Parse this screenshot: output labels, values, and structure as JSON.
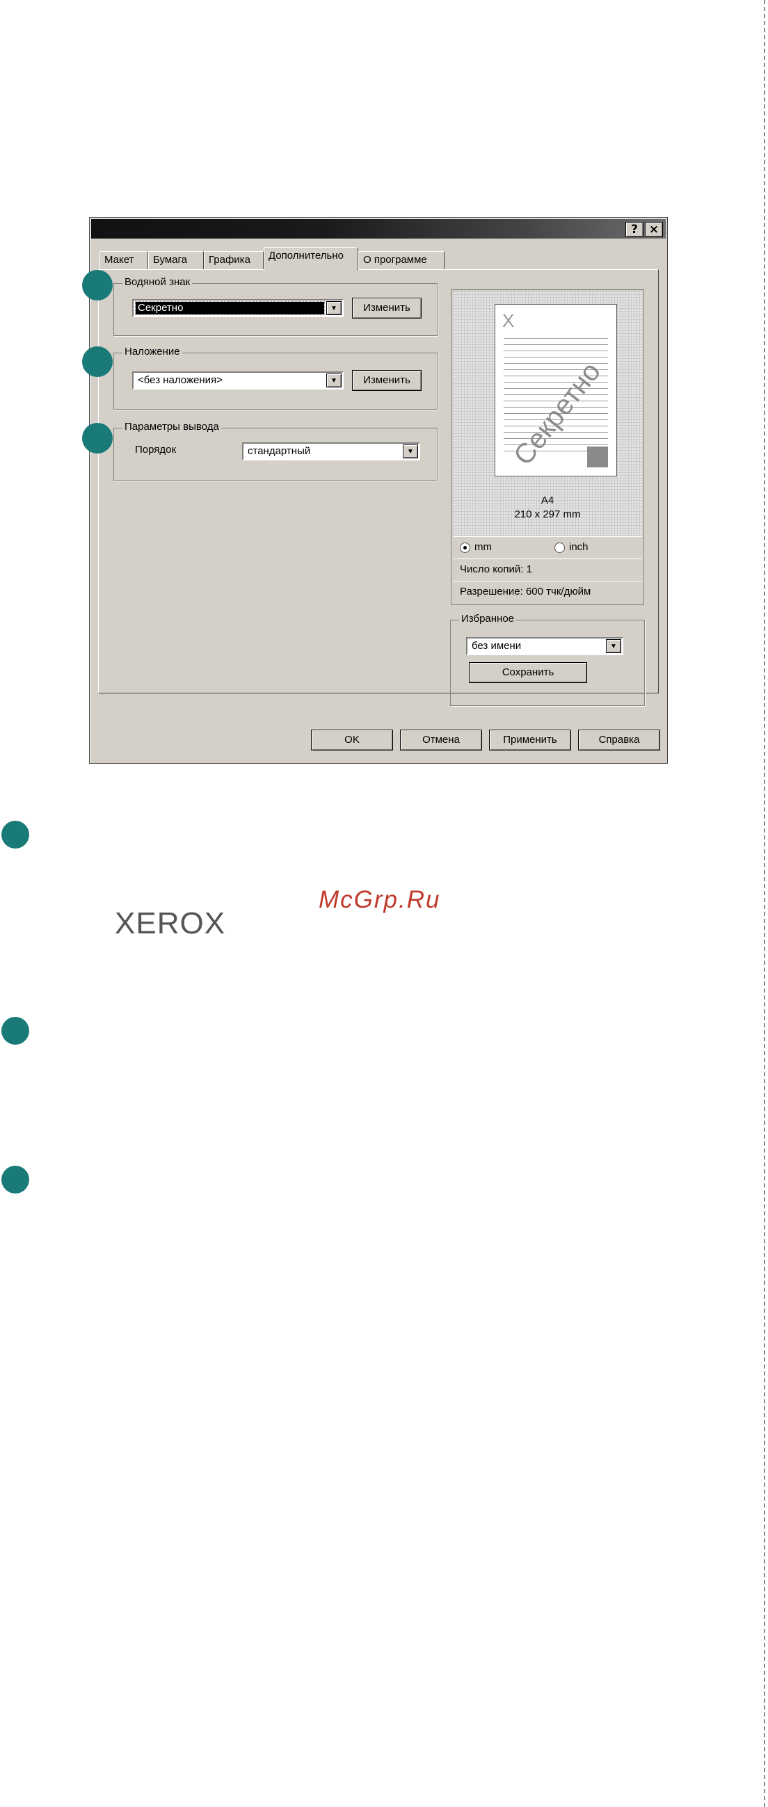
{
  "dialog": {
    "title_help_btn": "?",
    "title_close_btn": "×",
    "tabs": [
      {
        "label": "Макет"
      },
      {
        "label": "Бумага"
      },
      {
        "label": "Графика"
      },
      {
        "label": "Дополнительно",
        "active": true
      },
      {
        "label": "О программе"
      }
    ],
    "watermark_group": {
      "title": "Водяной знак",
      "selected": "Секретно",
      "edit_button": "Изменить"
    },
    "overlay_group": {
      "title": "Наложение",
      "selected": "<без наложения>",
      "edit_button": "Изменить"
    },
    "output_group": {
      "title": "Параметры вывода",
      "order_label": "Порядок",
      "order_value": "стандартный"
    },
    "preview": {
      "page_x": "X",
      "watermark": "Секретно",
      "paper": "A4",
      "size": "210 x 297 mm",
      "unit_mm": "mm",
      "unit_inch": "inch",
      "selected_unit": "mm",
      "copies": "Число копий: 1",
      "resolution": "Разрешение: 600 тчк/дюйм"
    },
    "favorites": {
      "title": "Избранное",
      "selected": "без имени",
      "save_button": "Сохранить"
    },
    "brand": "XEROX",
    "buttons": {
      "ok": "OK",
      "cancel": "Отмена",
      "apply": "Применить",
      "help": "Справка"
    }
  },
  "watermark_site": "McGrp.Ru",
  "colors": {
    "marker": "#1a7a78",
    "dialog_bg": "#d4d0c8",
    "site_watermark": "#c0392b"
  }
}
